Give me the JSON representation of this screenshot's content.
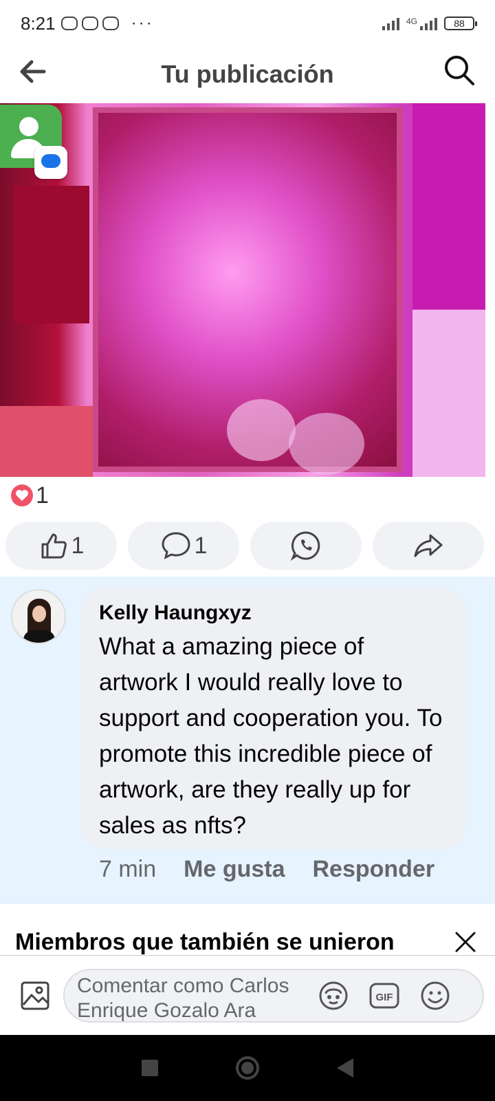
{
  "status_bar": {
    "time": "8:21",
    "dots": "···",
    "network": "4G",
    "battery": "88"
  },
  "topbar": {
    "title": "Tu publicación"
  },
  "post": {
    "reaction_count": "1",
    "like_count": "1",
    "comment_count": "1"
  },
  "comment": {
    "author": "Kelly Haungxyz",
    "text": "What a amazing piece of artwork I would really love to support and cooperation you. To promote this incredible piece of artwork, are they really up for sales as nfts?",
    "time": "7 min",
    "like_label": "Me gusta",
    "reply_label": "Responder"
  },
  "members": {
    "title": "Miembros que también se unieron"
  },
  "composer": {
    "placeholder": "Comentar como Carlos Enrique Gozalo Ara"
  },
  "colors": {
    "accent_blue": "#1877f2",
    "comment_area_bg": "#e7f3ff",
    "reaction_heart": "#f25268"
  }
}
